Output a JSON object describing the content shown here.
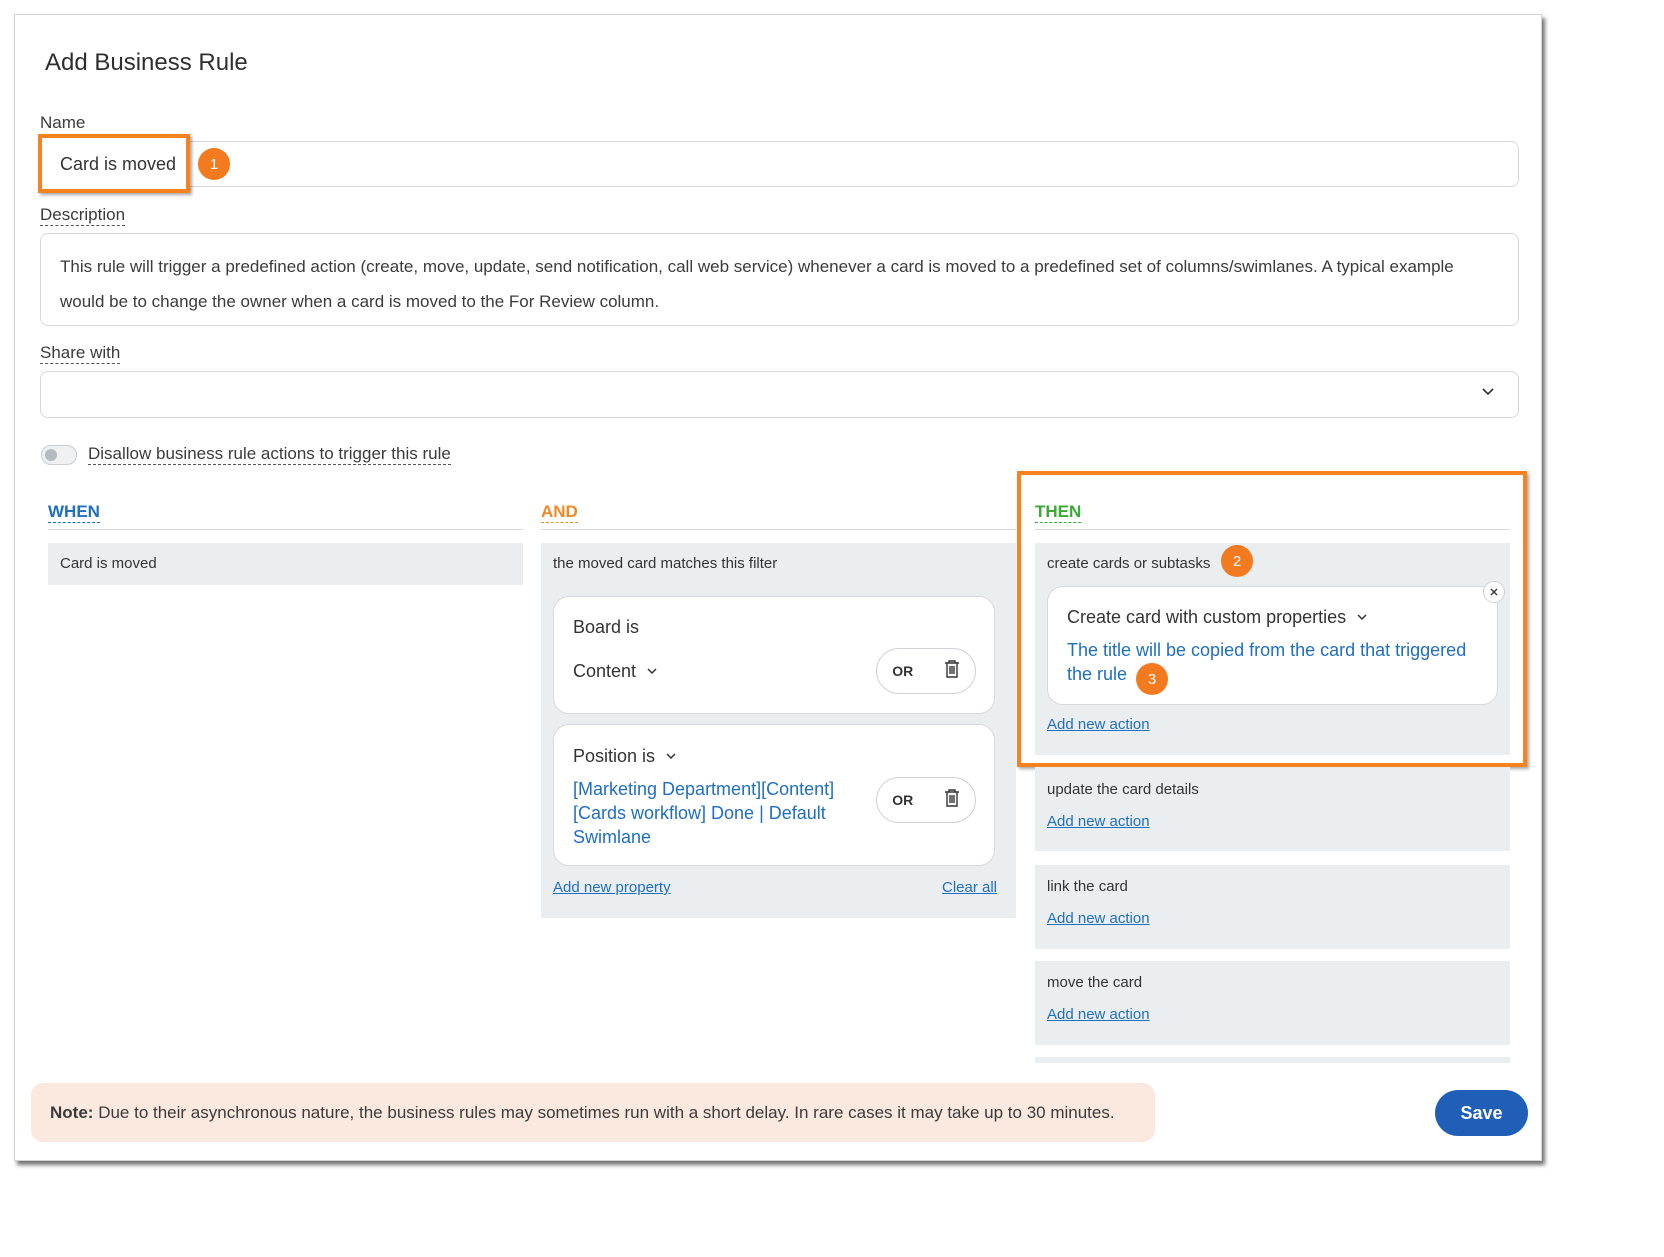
{
  "dialog": {
    "title": "Add Business Rule"
  },
  "name_field": {
    "label": "Name",
    "value": "Card is moved"
  },
  "description_field": {
    "label": "Description",
    "value": "This rule will trigger a predefined action (create, move, update, send notification, call web service) whenever a card is moved to a predefined set of columns/swimlanes. A typical example would be to change the owner when a card is moved to the For Review column."
  },
  "share_field": {
    "label": "Share with",
    "value": "",
    "icon": "chevron-down-icon"
  },
  "toggle": {
    "label": "Disallow business rule actions to trigger this rule",
    "state": "off"
  },
  "badges": [
    "1",
    "2",
    "3"
  ],
  "when": {
    "heading": "WHEN",
    "color": "#1f6fbf",
    "trigger": "Card is moved"
  },
  "and": {
    "heading": "AND",
    "color": "#f08a24",
    "panel_title": "the moved card matches this filter",
    "conditions": [
      {
        "label": "Board is",
        "value": "Content",
        "or_label": "OR"
      },
      {
        "label": "Position is",
        "value": "[Marketing Department][Content][Cards workflow] Done | Default Swimlane",
        "or_label": "OR"
      }
    ],
    "add_property": "Add new property",
    "clear_all": "Clear all"
  },
  "then": {
    "heading": "THEN",
    "color": "#3aaa35",
    "groups": [
      {
        "title": "create cards or subtasks",
        "action": {
          "label": "Create card with custom properties",
          "detail": "The title will be copied from the card that triggered the rule"
        },
        "add_action": "Add new action"
      },
      {
        "title": "update the card details",
        "add_action": "Add new action"
      },
      {
        "title": "link the card",
        "add_action": "Add new action"
      },
      {
        "title": "move the card",
        "add_action": "Add new action"
      }
    ]
  },
  "note": {
    "prefix": "Note:",
    "text": "Due to their asynchronous nature, the business rules may sometimes run with a short delay. In rare cases it may take up to 30 minutes."
  },
  "save_button": "Save",
  "colors": {
    "highlight": "#f7831f",
    "badge": "#f47a1f",
    "link": "#1f6fbf",
    "save": "#1f5fb8",
    "note_bg": "#fbe9df"
  }
}
